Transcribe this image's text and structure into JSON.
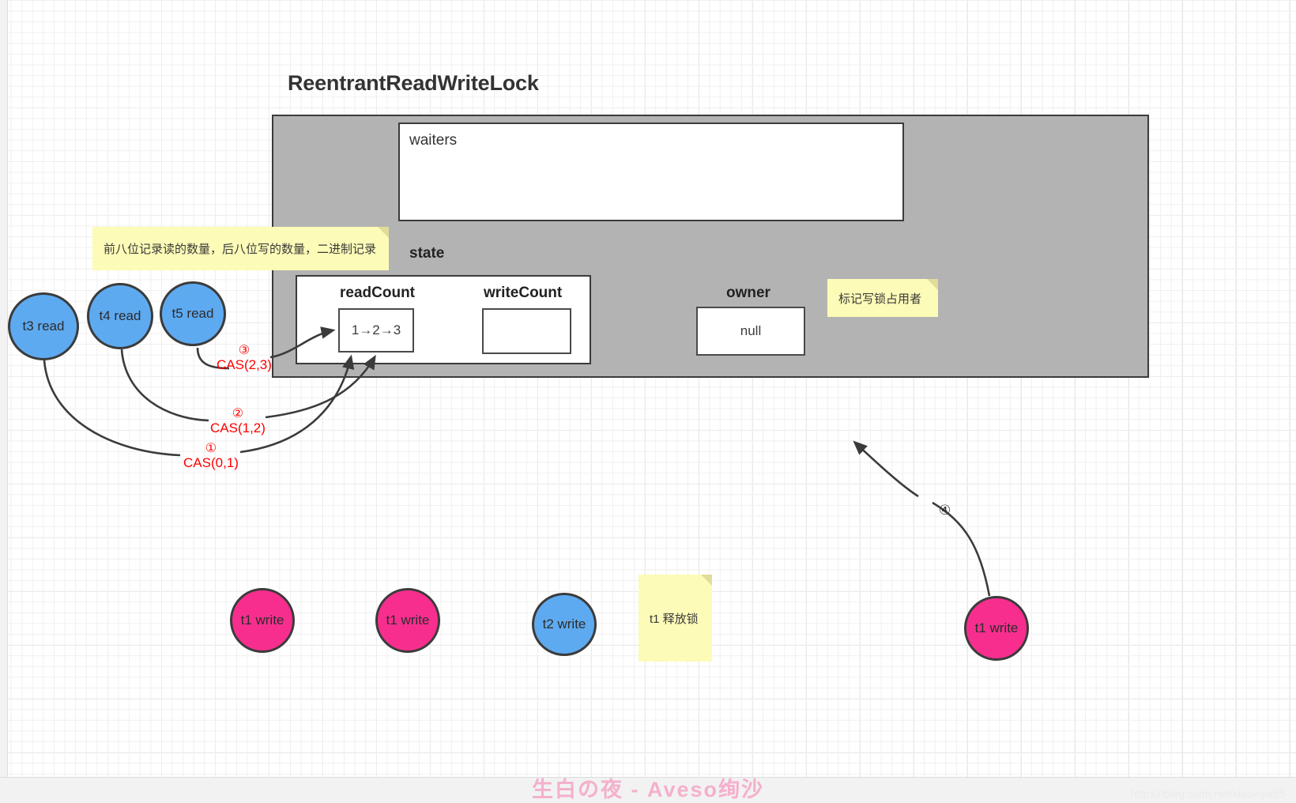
{
  "diagram": {
    "title": "ReentrantReadWriteLock",
    "lock_container": {
      "waiters_label": "waiters",
      "state_label": "state",
      "fields": [
        {
          "name": "readCount",
          "value": "1→2→3"
        },
        {
          "name": "writeCount",
          "value": ""
        },
        {
          "name": "owner",
          "value": "null"
        }
      ]
    },
    "notes": [
      {
        "id": "state-note",
        "text": "前八位记录读的数量，后八位写的数量，二进制记录"
      },
      {
        "id": "owner-note",
        "text": "标记写锁占用者"
      },
      {
        "id": "release-note",
        "text": "t1 释放锁"
      }
    ],
    "reader_threads": [
      {
        "label": "t3 read",
        "color": "#5eaaf0"
      },
      {
        "label": "t4 read",
        "color": "#5eaaf0"
      },
      {
        "label": "t5 read",
        "color": "#5eaaf0"
      }
    ],
    "writer_threads": [
      {
        "label": "t1 write",
        "color": "#f72e8e"
      },
      {
        "label": "t1 write",
        "color": "#f72e8e"
      },
      {
        "label": "t2 write",
        "color": "#5eaaf0"
      },
      {
        "label": "t1 write",
        "color": "#f72e8e"
      }
    ],
    "cas_steps": [
      {
        "num": "①",
        "text": "CAS(0,1)"
      },
      {
        "num": "②",
        "text": "CAS(1,2)"
      },
      {
        "num": "③",
        "text": "CAS(2,3)"
      }
    ],
    "step_markers": [
      {
        "num": "④"
      }
    ],
    "colors": {
      "read_thread": "#5eaaf0",
      "write_thread": "#f72e8e",
      "note": "#fcfbb7",
      "container": "#b3b3b3",
      "cas_text": "#ff0000"
    }
  },
  "watermarks": {
    "center": "生白の夜 - Aveso绚沙",
    "url": "https://blog.csdn.net/xiaoxiya55"
  }
}
